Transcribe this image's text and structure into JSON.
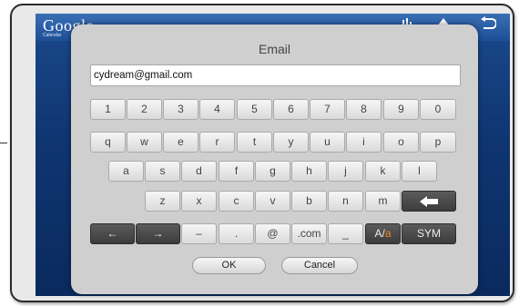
{
  "app": {
    "logo_text": "Google",
    "logo_sub": "Calendar"
  },
  "topbar_icons": [
    "settings-icon",
    "up-arrow-icon",
    "back-icon"
  ],
  "dialog": {
    "title": "Email",
    "input_value": "cydream@gmail.com"
  },
  "keyboard": {
    "row1": [
      "1",
      "2",
      "3",
      "4",
      "5",
      "6",
      "7",
      "8",
      "9",
      "0"
    ],
    "row2": [
      "q",
      "w",
      "e",
      "r",
      "t",
      "y",
      "u",
      "i",
      "o",
      "p"
    ],
    "row3": [
      "a",
      "s",
      "d",
      "f",
      "g",
      "h",
      "j",
      "k",
      "l"
    ],
    "row4": [
      "z",
      "x",
      "c",
      "v",
      "b",
      "n",
      "m"
    ],
    "row5": {
      "left_arrow": "←",
      "right_arrow": "→",
      "dash": "–",
      "dot": ".",
      "at": "@",
      "dotcom": ".com",
      "underscore": "_",
      "case_a": "A/",
      "case_b": "a",
      "sym": "SYM"
    },
    "backspace_icon": "backspace-arrow-icon"
  },
  "buttons": {
    "ok": "OK",
    "cancel": "Cancel"
  }
}
